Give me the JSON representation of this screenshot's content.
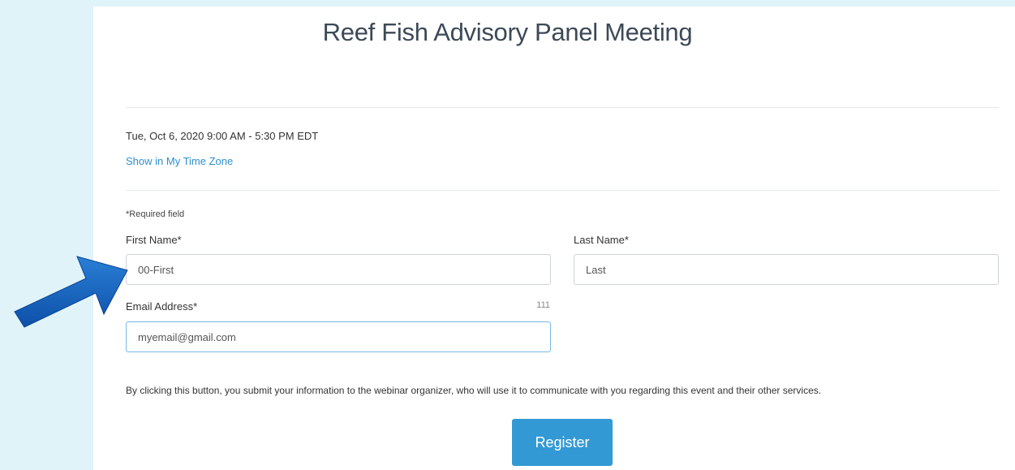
{
  "event": {
    "title": "Reef Fish Advisory Panel Meeting",
    "datetime": "Tue, Oct 6, 2020 9:00 AM - 5:30 PM EDT",
    "timezone_link": "Show in My Time Zone"
  },
  "form": {
    "required_note": "*Required field",
    "first_name": {
      "label": "First Name*",
      "value": "00-First"
    },
    "last_name": {
      "label": "Last Name*",
      "value": "Last"
    },
    "email": {
      "label": "Email Address*",
      "counter": "111",
      "value": "myemail@gmail.com"
    },
    "notice": "By clicking this button, you submit your information to the webinar organizer, who will use it to communicate with you regarding this event and their other services.",
    "register_label": "Register"
  },
  "annotation": {
    "icon": "arrow-right-icon",
    "color": "#1565c0"
  },
  "colors": {
    "accent": "#3399d4",
    "link": "#2e8fd0",
    "background": "#dff3f8"
  }
}
